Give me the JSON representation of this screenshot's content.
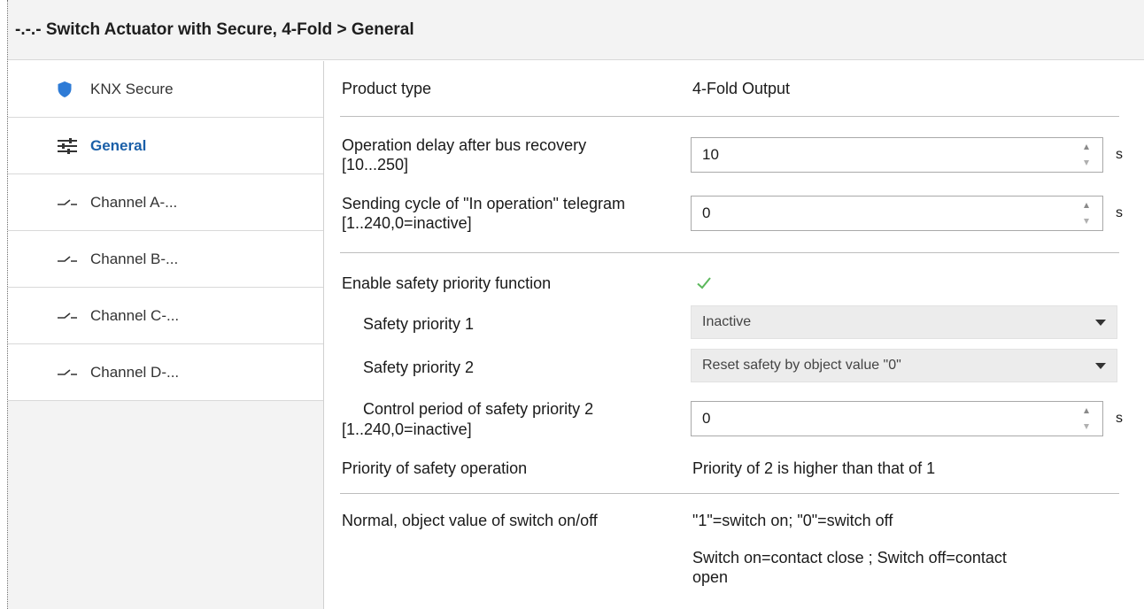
{
  "window": {
    "title": "-.-.- Switch Actuator with Secure, 4-Fold > General"
  },
  "sidebar": {
    "items": [
      {
        "label": "KNX Secure",
        "icon": "shield-icon"
      },
      {
        "label": "General",
        "icon": "sliders-icon",
        "active": true
      },
      {
        "label": "Channel A-...",
        "icon": "switch-contact-icon"
      },
      {
        "label": "Channel B-...",
        "icon": "switch-contact-icon"
      },
      {
        "label": "Channel C-...",
        "icon": "switch-contact-icon"
      },
      {
        "label": "Channel D-...",
        "icon": "switch-contact-icon"
      }
    ]
  },
  "colors": {
    "accent": "#1a5fa8",
    "shield": "#2e7bd6",
    "check": "#5cb85c"
  },
  "params": {
    "product_type": {
      "label": "Product type",
      "value": "4-Fold Output"
    },
    "operation_delay": {
      "label_line1": "Operation delay after bus recovery",
      "label_line2": "[10...250]",
      "value": "10",
      "unit": "s"
    },
    "sending_cycle": {
      "label_line1": "Sending cycle of \"In operation\" telegram",
      "label_line2": "[1..240,0=inactive]",
      "value": "0",
      "unit": "s"
    },
    "enable_safety": {
      "label": "Enable safety priority function",
      "checked": true
    },
    "safety_priority_1": {
      "label": "Safety priority 1",
      "value": "Inactive"
    },
    "safety_priority_2": {
      "label": "Safety priority 2",
      "value": "Reset safety by object value \"0\""
    },
    "control_period": {
      "label_line1": "Control period of safety priority 2",
      "label_line2": "[1..240,0=inactive]",
      "value": "0",
      "unit": "s"
    },
    "priority_operation": {
      "label": "Priority of safety operation",
      "value": "Priority of 2 is higher than that of 1"
    },
    "normal_object": {
      "label": "Normal, object value of switch on/off",
      "value": "\"1\"=switch on; \"0\"=switch off",
      "note_line1": "Switch on=contact close ; Switch off=contact",
      "note_line2": "open"
    }
  }
}
